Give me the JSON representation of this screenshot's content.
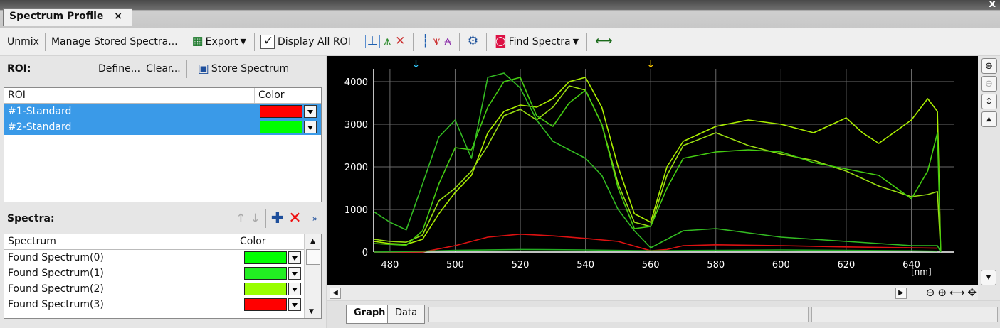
{
  "tab": {
    "title": "Spectrum Profile",
    "close": "×"
  },
  "window": {
    "close": "x"
  },
  "toolbar": {
    "unmix": "Unmix",
    "manage": "Manage Stored Spectra...",
    "export": "Export",
    "display_all_roi": "Display All ROI",
    "find_spectra": "Find Spectra"
  },
  "roi": {
    "label": "ROI:",
    "define": "Define...",
    "clear": "Clear...",
    "store": "Store Spectrum",
    "columns": [
      "ROI",
      "Color"
    ],
    "rows": [
      {
        "name": "#1-Standard",
        "color": "#ff0000"
      },
      {
        "name": "#2-Standard",
        "color": "#00ff00"
      }
    ]
  },
  "spectra": {
    "label": "Spectra:",
    "columns": [
      "Spectrum",
      "Color"
    ],
    "rows": [
      {
        "name": "Found Spectrum(0)",
        "color": "#00ff00"
      },
      {
        "name": "Found Spectrum(1)",
        "color": "#22ee22"
      },
      {
        "name": "Found Spectrum(2)",
        "color": "#99ff00"
      },
      {
        "name": "Found Spectrum(3)",
        "color": "#ff0000"
      }
    ]
  },
  "bottom_tabs": [
    "Graph",
    "Data"
  ],
  "chart_data": {
    "type": "line",
    "x_unit_label": "[nm]",
    "xlim": [
      475,
      653
    ],
    "ylim": [
      0,
      4300
    ],
    "xticks": [
      480,
      500,
      520,
      540,
      560,
      580,
      600,
      620,
      640
    ],
    "yticks": [
      0,
      1000,
      2000,
      3000,
      4000
    ],
    "grid": true,
    "markers": [
      {
        "x": 488,
        "color": "#33ccff"
      },
      {
        "x": 560,
        "color": "#ffcc00"
      }
    ],
    "series": [
      {
        "color": "#aaee00",
        "x": [
          475,
          480,
          485,
          490,
          495,
          500,
          505,
          510,
          515,
          520,
          525,
          530,
          535,
          540,
          545,
          550,
          555,
          560,
          565,
          570,
          580,
          590,
          600,
          610,
          620,
          625,
          630,
          640,
          645,
          648,
          649
        ],
        "y": [
          250,
          200,
          180,
          300,
          900,
          1400,
          1800,
          2800,
          3300,
          3450,
          3400,
          3600,
          4000,
          4100,
          3400,
          2000,
          900,
          700,
          2000,
          2600,
          2950,
          3100,
          3000,
          2800,
          3150,
          2800,
          2550,
          3100,
          3600,
          3300,
          0
        ]
      },
      {
        "color": "#99dd11",
        "x": [
          475,
          480,
          485,
          490,
          495,
          500,
          505,
          510,
          515,
          520,
          525,
          530,
          535,
          540,
          545,
          550,
          555,
          560,
          565,
          570,
          580,
          590,
          600,
          610,
          620,
          630,
          640,
          645,
          648,
          649
        ],
        "y": [
          300,
          250,
          230,
          400,
          1200,
          1500,
          1900,
          2500,
          3200,
          3350,
          3100,
          3400,
          3900,
          3800,
          3000,
          1600,
          700,
          600,
          1800,
          2500,
          2800,
          2500,
          2300,
          2150,
          1900,
          1550,
          1300,
          1350,
          1420,
          0
        ]
      },
      {
        "color": "#44cc11",
        "x": [
          475,
          480,
          485,
          490,
          495,
          500,
          505,
          510,
          515,
          520,
          525,
          530,
          535,
          540,
          545,
          550,
          555,
          560,
          565,
          570,
          580,
          590,
          600,
          610,
          620,
          630,
          640,
          645,
          648,
          649
        ],
        "y": [
          200,
          180,
          160,
          500,
          1600,
          2450,
          2400,
          3400,
          4000,
          4100,
          3200,
          2950,
          3500,
          3800,
          3000,
          1500,
          550,
          600,
          1500,
          2200,
          2350,
          2400,
          2350,
          2100,
          1950,
          1800,
          1250,
          1900,
          2800,
          0
        ]
      },
      {
        "color": "#33bb22",
        "x": [
          475,
          480,
          485,
          490,
          495,
          500,
          505,
          510,
          515,
          520,
          525,
          530,
          535,
          540,
          545,
          550,
          555,
          560,
          565,
          570,
          580,
          590,
          600,
          610,
          620,
          630,
          640,
          648,
          649
        ],
        "y": [
          950,
          700,
          520,
          1600,
          2700,
          3100,
          2200,
          4100,
          4200,
          3850,
          3100,
          2600,
          2400,
          2200,
          1800,
          1000,
          500,
          100,
          300,
          500,
          550,
          450,
          350,
          300,
          250,
          200,
          150,
          150,
          0
        ]
      },
      {
        "color": "#dd1111",
        "x": [
          475,
          490,
          500,
          510,
          520,
          530,
          540,
          550,
          560,
          565,
          570,
          580,
          600,
          620,
          640,
          648
        ],
        "y": [
          0,
          0,
          150,
          350,
          420,
          380,
          320,
          250,
          30,
          60,
          150,
          170,
          150,
          120,
          100,
          90
        ]
      },
      {
        "color": "#22aa22",
        "x": [
          475,
          490,
          500,
          520,
          540,
          560,
          580,
          600,
          620,
          640,
          648
        ],
        "y": [
          0,
          20,
          40,
          60,
          50,
          30,
          40,
          50,
          40,
          30,
          20
        ]
      }
    ]
  }
}
